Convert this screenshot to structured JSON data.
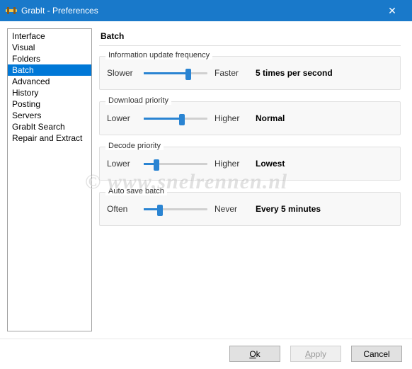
{
  "window": {
    "title": "GrabIt - Preferences"
  },
  "sidebar": {
    "items": [
      {
        "label": "Interface",
        "selected": false
      },
      {
        "label": "Visual",
        "selected": false
      },
      {
        "label": "Folders",
        "selected": false
      },
      {
        "label": "Batch",
        "selected": true
      },
      {
        "label": "Advanced",
        "selected": false
      },
      {
        "label": "History",
        "selected": false
      },
      {
        "label": "Posting",
        "selected": false
      },
      {
        "label": "Servers",
        "selected": false
      },
      {
        "label": "GrabIt Search",
        "selected": false
      },
      {
        "label": "Repair and Extract",
        "selected": false
      }
    ]
  },
  "page": {
    "title": "Batch"
  },
  "groups": [
    {
      "label": "Information update frequency",
      "left": "Slower",
      "right": "Faster",
      "value": "5 times per second",
      "pos": 70
    },
    {
      "label": "Download priority",
      "left": "Lower",
      "right": "Higher",
      "value": "Normal",
      "pos": 60
    },
    {
      "label": "Decode priority",
      "left": "Lower",
      "right": "Higher",
      "value": "Lowest",
      "pos": 20
    },
    {
      "label": "Auto save batch",
      "left": "Often",
      "right": "Never",
      "value": "Every 5 minutes",
      "pos": 25
    }
  ],
  "buttons": {
    "ok": "Ok",
    "apply": "Apply",
    "cancel": "Cancel"
  },
  "watermark": "© www.snelrennen.nl"
}
